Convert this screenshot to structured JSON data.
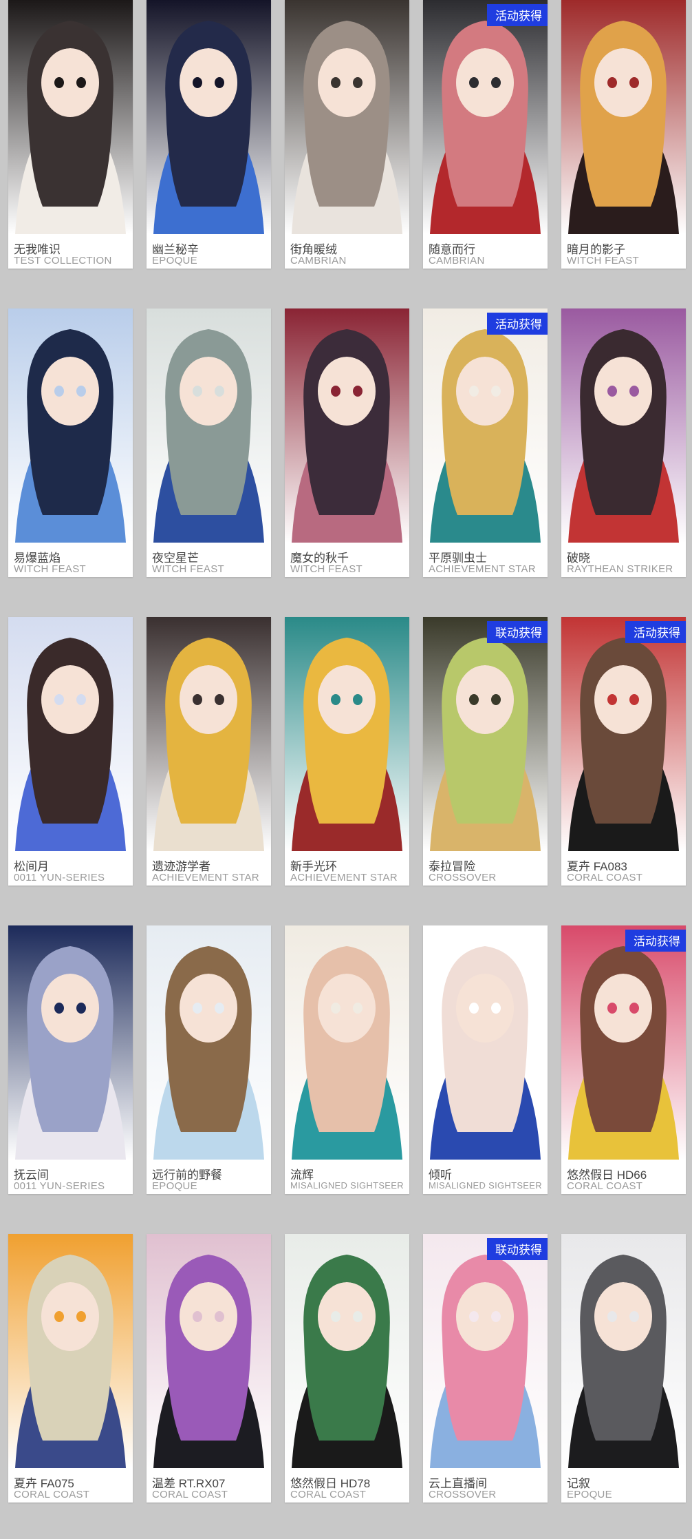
{
  "accent_color": "#1f3de0",
  "cards": [
    {
      "name": "无我唯识",
      "series": "TEST COLLECTION",
      "badge": "",
      "palette": [
        "#3a3232",
        "#f1ece6",
        "#1c1818"
      ]
    },
    {
      "name": "幽兰秘辛",
      "series": "EPOQUE",
      "badge": "",
      "palette": [
        "#232a4a",
        "#3d6fd0",
        "#141428"
      ]
    },
    {
      "name": "街角暖绒",
      "series": "CAMBRIAN",
      "badge": "",
      "palette": [
        "#9c8f86",
        "#e9e3dd",
        "#3a3430"
      ]
    },
    {
      "name": "随意而行",
      "series": "CAMBRIAN",
      "badge": "活动获得",
      "palette": [
        "#d37a80",
        "#b3282c",
        "#2c2c30"
      ]
    },
    {
      "name": "暗月的影子",
      "series": "WITCH FEAST",
      "badge": "",
      "palette": [
        "#e0a24a",
        "#2a1c1c",
        "#9e2a2a"
      ]
    },
    {
      "name": "易爆蓝焰",
      "series": "WITCH FEAST",
      "badge": "",
      "palette": [
        "#1e2a4a",
        "#5b8ed8",
        "#b9cdea"
      ]
    },
    {
      "name": "夜空星芒",
      "series": "WITCH FEAST",
      "badge": "",
      "palette": [
        "#8a9a96",
        "#2d4fa0",
        "#d8dedc"
      ]
    },
    {
      "name": "魔女的秋千",
      "series": "WITCH FEAST",
      "badge": "",
      "palette": [
        "#3c2c3a",
        "#b86a80",
        "#8a2434"
      ]
    },
    {
      "name": "平原驯虫士",
      "series": "ACHIEVEMENT STAR",
      "badge": "活动获得",
      "palette": [
        "#d9b25a",
        "#2a8a8c",
        "#f1ece4"
      ]
    },
    {
      "name": "破晓",
      "series": "RAYTHEAN STRIKER",
      "badge": "",
      "palette": [
        "#3a2a30",
        "#c23434",
        "#9a5aa0"
      ]
    },
    {
      "name": "松间月",
      "series": "0011 YUN-SERIES",
      "badge": "",
      "palette": [
        "#3a2a2a",
        "#4d6ad6",
        "#d4dcf0"
      ]
    },
    {
      "name": "遗迹游学者",
      "series": "ACHIEVEMENT STAR",
      "badge": "",
      "palette": [
        "#e4b440",
        "#eadfcf",
        "#3a3030"
      ]
    },
    {
      "name": "新手光环",
      "series": "ACHIEVEMENT STAR",
      "badge": "",
      "palette": [
        "#eab840",
        "#9a2a2a",
        "#2a8a88"
      ]
    },
    {
      "name": "泰拉冒险",
      "series": "CROSSOVER",
      "badge": "联动获得",
      "palette": [
        "#b8c86a",
        "#d9b46a",
        "#3a3a2a"
      ]
    },
    {
      "name": "夏卉 FA083",
      "series": "CORAL COAST",
      "badge": "活动获得",
      "palette": [
        "#6a4a3a",
        "#1a1a1a",
        "#c23434"
      ]
    },
    {
      "name": "抚云间",
      "series": "0011 YUN-SERIES",
      "badge": "",
      "palette": [
        "#9aa2c8",
        "#e9e6ee",
        "#1c2a5a"
      ]
    },
    {
      "name": "远行前的野餐",
      "series": "EPOQUE",
      "badge": "",
      "palette": [
        "#8a6a4a",
        "#bcd8ec",
        "#e6ecf2"
      ]
    },
    {
      "name": "流辉",
      "series": "MISALIGNED SIGHTSEER",
      "badge": "",
      "palette": [
        "#e6c0aa",
        "#2a9aa0",
        "#f0ebe2"
      ]
    },
    {
      "name": "倾听",
      "series": "MISALIGNED SIGHTSEER",
      "badge": "",
      "palette": [
        "#f0ddd6",
        "#2a4ab0",
        "#ffffff"
      ]
    },
    {
      "name": "悠然假日 HD66",
      "series": "CORAL COAST",
      "badge": "活动获得",
      "palette": [
        "#7a4a3a",
        "#e8c23a",
        "#d84a6a"
      ]
    },
    {
      "name": "夏卉 FA075",
      "series": "CORAL COAST",
      "badge": "",
      "palette": [
        "#d9d2b8",
        "#3a4a8a",
        "#f0a030"
      ]
    },
    {
      "name": "温差 RT.RX07",
      "series": "CORAL COAST",
      "badge": "",
      "palette": [
        "#9a5ab8",
        "#1c1c22",
        "#e0c0d0"
      ]
    },
    {
      "name": "悠然假日 HD78",
      "series": "CORAL COAST",
      "badge": "",
      "palette": [
        "#3a7a4a",
        "#1a1a1a",
        "#e8ece8"
      ]
    },
    {
      "name": "云上直播间",
      "series": "CROSSOVER",
      "badge": "联动获得",
      "palette": [
        "#e88aa8",
        "#8ab0e0",
        "#f4e8ee"
      ]
    },
    {
      "name": "记叙",
      "series": "EPOQUE",
      "badge": "",
      "palette": [
        "#5a5a5e",
        "#1c1c1e",
        "#e8e8ea"
      ]
    }
  ]
}
